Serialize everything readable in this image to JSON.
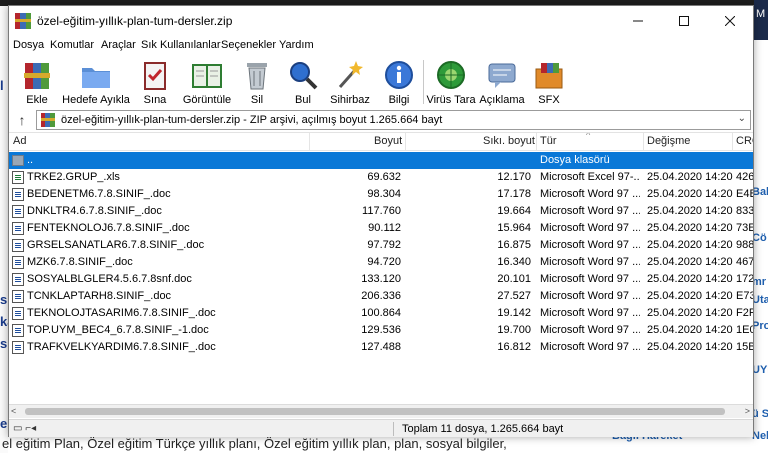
{
  "background": {
    "left_fragments": [
      "l",
      "si",
      "ka",
      "si",
      "e"
    ],
    "right_fragments": [
      "Bala",
      "Cö",
      "mr",
      "Uta",
      "Pro",
      "UYM",
      "ü S",
      "Nehir"
    ],
    "bottom_text": "el eğitim Plan, Özel eğitim Türkçe yıllık planı, Özel eğitim yıllık plan, plan, sosyal bilgiler,",
    "bottom_right_text": "Bağlı Hareket -",
    "top_right_letter": "M"
  },
  "window": {
    "title": "özel-eğitim-yıllık-plan-tum-dersler.zip",
    "controls": {
      "minimize": "—",
      "maximize": "☐",
      "close": "✕"
    }
  },
  "menu": [
    "Dosya",
    "Komutlar",
    "Araçlar",
    "Sık Kullanılanlar",
    "Seçenekler",
    "Yardım"
  ],
  "toolbar": [
    {
      "label": "Ekle",
      "icon": "rar-books-icon"
    },
    {
      "label": "Hedefe Ayıkla",
      "icon": "folder-icon"
    },
    {
      "label": "Sına",
      "icon": "clipboard-check-icon"
    },
    {
      "label": "Görüntüle",
      "icon": "book-icon"
    },
    {
      "label": "Sil",
      "icon": "trash-icon"
    },
    {
      "label": "Bul",
      "icon": "magnifier-icon"
    },
    {
      "label": "Sihirbaz",
      "icon": "wand-icon"
    },
    {
      "label": "Bilgi",
      "icon": "info-icon"
    },
    {
      "label": "Virüs Tara",
      "icon": "virus-scan-icon"
    },
    {
      "label": "Açıklama",
      "icon": "comment-icon"
    },
    {
      "label": "SFX",
      "icon": "sfx-icon"
    }
  ],
  "address": {
    "up_glyph": "↑",
    "path": "özel-eğitim-yıllık-plan-tum-dersler.zip - ZIP arşivi, açılmış boyut 1.265.664 bayt",
    "dropdown_glyph": "⌄"
  },
  "columns": {
    "name": "Ad",
    "size": "Boyut",
    "packed": "Sıkı. boyut",
    "type": "Tür",
    "modified": "Değişme",
    "crc": "CRC",
    "sort_glyph": "^"
  },
  "files": [
    {
      "name": "..",
      "size": "",
      "packed": "",
      "type": "Dosya klasörü",
      "modified": "",
      "crc": "",
      "kind": "folder"
    },
    {
      "name": "TRKE2.GRUP_.xls",
      "size": "69.632",
      "packed": "12.170",
      "type": "Microsoft Excel 97-...",
      "modified": "25.04.2020 14:20",
      "crc": "426",
      "kind": "xls"
    },
    {
      "name": "BEDENETM6.7.8.SINIF_.doc",
      "size": "98.304",
      "packed": "17.178",
      "type": "Microsoft Word 97 ...",
      "modified": "25.04.2020 14:20",
      "crc": "E4B",
      "kind": "doc"
    },
    {
      "name": "DNKLTR4.6.7.8.SINIF_.doc",
      "size": "117.760",
      "packed": "19.664",
      "type": "Microsoft Word 97 ...",
      "modified": "25.04.2020 14:20",
      "crc": "833",
      "kind": "doc"
    },
    {
      "name": "FENTEKNOLOJ6.7.8.SINIF_.doc",
      "size": "90.112",
      "packed": "15.964",
      "type": "Microsoft Word 97 ...",
      "modified": "25.04.2020 14:20",
      "crc": "73E",
      "kind": "doc"
    },
    {
      "name": "GRSELSANATLAR6.7.8.SINIF_.doc",
      "size": "97.792",
      "packed": "16.875",
      "type": "Microsoft Word 97 ...",
      "modified": "25.04.2020 14:20",
      "crc": "988",
      "kind": "doc"
    },
    {
      "name": "MZK6.7.8.SINIF_.doc",
      "size": "94.720",
      "packed": "16.340",
      "type": "Microsoft Word 97 ...",
      "modified": "25.04.2020 14:20",
      "crc": "467",
      "kind": "doc"
    },
    {
      "name": "SOSYALBLGLER4.5.6.7.8snf.doc",
      "size": "133.120",
      "packed": "20.101",
      "type": "Microsoft Word 97 ...",
      "modified": "25.04.2020 14:20",
      "crc": "172",
      "kind": "doc"
    },
    {
      "name": "TCNKLAPTARH8.SINIF_.doc",
      "size": "206.336",
      "packed": "27.527",
      "type": "Microsoft Word 97 ...",
      "modified": "25.04.2020 14:20",
      "crc": "E73",
      "kind": "doc"
    },
    {
      "name": "TEKNOLOJTASARIM6.7.8.SINIF_.doc",
      "size": "100.864",
      "packed": "19.142",
      "type": "Microsoft Word 97 ...",
      "modified": "25.04.2020 14:20",
      "crc": "F2F",
      "kind": "doc"
    },
    {
      "name": "TOP.UYM_BEC4_6.7.8.SINIF_-1.doc",
      "size": "129.536",
      "packed": "19.700",
      "type": "Microsoft Word 97 ...",
      "modified": "25.04.2020 14:20",
      "crc": "1E0",
      "kind": "doc"
    },
    {
      "name": "TRAFKVELKYARDIM6.7.8.SINIF_.doc",
      "size": "127.488",
      "packed": "16.812",
      "type": "Microsoft Word 97 ...",
      "modified": "25.04.2020 14:20",
      "crc": "15B",
      "kind": "doc"
    }
  ],
  "scroll": {
    "left_glyph": "<",
    "right_glyph": ">"
  },
  "status": {
    "icons": "▭ ⌐◂",
    "text": "Toplam 11 dosya, 1.265.664 bayt"
  }
}
